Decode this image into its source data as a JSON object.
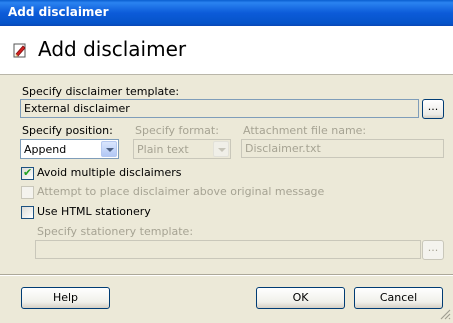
{
  "window": {
    "title": "Add disclaimer"
  },
  "header": {
    "title": "Add disclaimer",
    "icon": "edit-disclaimer-icon"
  },
  "template": {
    "label": "Specify disclaimer template:",
    "value": "External disclaimer",
    "browse_label": "..."
  },
  "position": {
    "label": "Specify position:",
    "value": "Append"
  },
  "format": {
    "label": "Specify format:",
    "value": "Plain text"
  },
  "attachment": {
    "label": "Attachment file name:",
    "value": "Disclaimer.txt"
  },
  "options": {
    "avoid_multiple": {
      "label": "Avoid multiple disclaimers",
      "checked": true
    },
    "place_above": {
      "label": "Attempt to place disclaimer above original message",
      "checked": false
    }
  },
  "stationery": {
    "use_label": "Use HTML stationery",
    "checked": false,
    "template_label": "Specify stationery template:",
    "value": "",
    "browse_label": "..."
  },
  "buttons": {
    "help": "Help",
    "ok": "OK",
    "cancel": "Cancel"
  }
}
